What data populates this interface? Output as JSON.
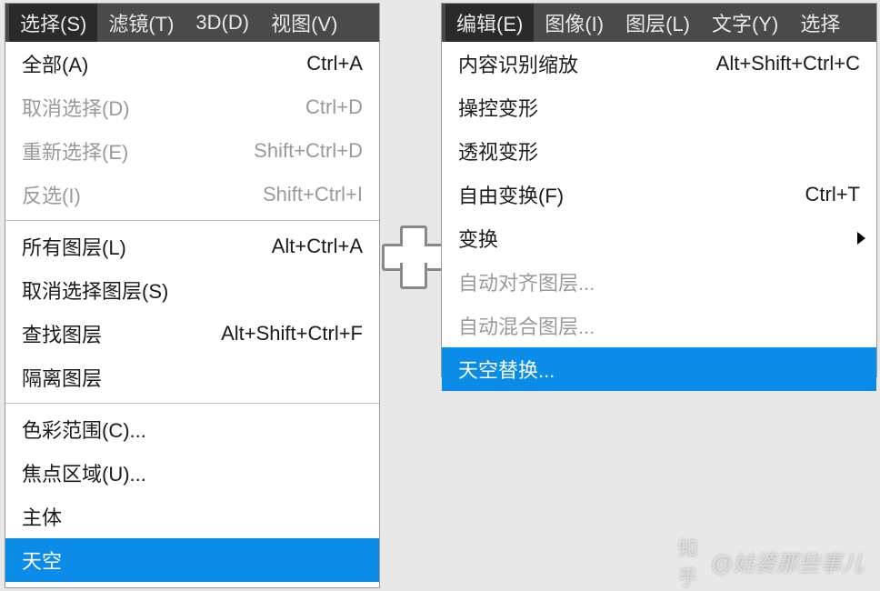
{
  "left": {
    "menubar": [
      {
        "label": "选择(S)",
        "active": true
      },
      {
        "label": "滤镜(T)",
        "active": false
      },
      {
        "label": "3D(D)",
        "active": false
      },
      {
        "label": "视图(V)",
        "active": false
      }
    ],
    "groups": [
      [
        {
          "label": "全部(A)",
          "shortcut": "Ctrl+A",
          "disabled": false
        },
        {
          "label": "取消选择(D)",
          "shortcut": "Ctrl+D",
          "disabled": true
        },
        {
          "label": "重新选择(E)",
          "shortcut": "Shift+Ctrl+D",
          "disabled": true
        },
        {
          "label": "反选(I)",
          "shortcut": "Shift+Ctrl+I",
          "disabled": true
        }
      ],
      [
        {
          "label": "所有图层(L)",
          "shortcut": "Alt+Ctrl+A",
          "disabled": false
        },
        {
          "label": "取消选择图层(S)",
          "shortcut": "",
          "disabled": false
        },
        {
          "label": "查找图层",
          "shortcut": "Alt+Shift+Ctrl+F",
          "disabled": false
        },
        {
          "label": "隔离图层",
          "shortcut": "",
          "disabled": false
        }
      ],
      [
        {
          "label": "色彩范围(C)...",
          "shortcut": "",
          "disabled": false
        },
        {
          "label": "焦点区域(U)...",
          "shortcut": "",
          "disabled": false
        },
        {
          "label": "主体",
          "shortcut": "",
          "disabled": false
        },
        {
          "label": "天空",
          "shortcut": "",
          "disabled": false,
          "highlight": true
        }
      ]
    ]
  },
  "right": {
    "menubar": [
      {
        "label": "编辑(E)",
        "active": true
      },
      {
        "label": "图像(I)",
        "active": false
      },
      {
        "label": "图层(L)",
        "active": false
      },
      {
        "label": "文字(Y)",
        "active": false
      },
      {
        "label": "选择",
        "active": false
      }
    ],
    "groups": [
      [
        {
          "label": "内容识别缩放",
          "shortcut": "Alt+Shift+Ctrl+C",
          "disabled": false
        },
        {
          "label": "操控变形",
          "shortcut": "",
          "disabled": false
        },
        {
          "label": "透视变形",
          "shortcut": "",
          "disabled": false
        },
        {
          "label": "自由变换(F)",
          "shortcut": "Ctrl+T",
          "disabled": false
        },
        {
          "label": "变换",
          "shortcut": "",
          "disabled": false,
          "submenu": true
        },
        {
          "label": "自动对齐图层...",
          "shortcut": "",
          "disabled": true
        },
        {
          "label": "自动混合图层...",
          "shortcut": "",
          "disabled": true
        },
        {
          "label": "天空替换...",
          "shortcut": "",
          "disabled": false,
          "highlight": true
        }
      ]
    ]
  },
  "watermark": {
    "prefix": "知乎",
    "user": "@姑婆那些事儿"
  }
}
